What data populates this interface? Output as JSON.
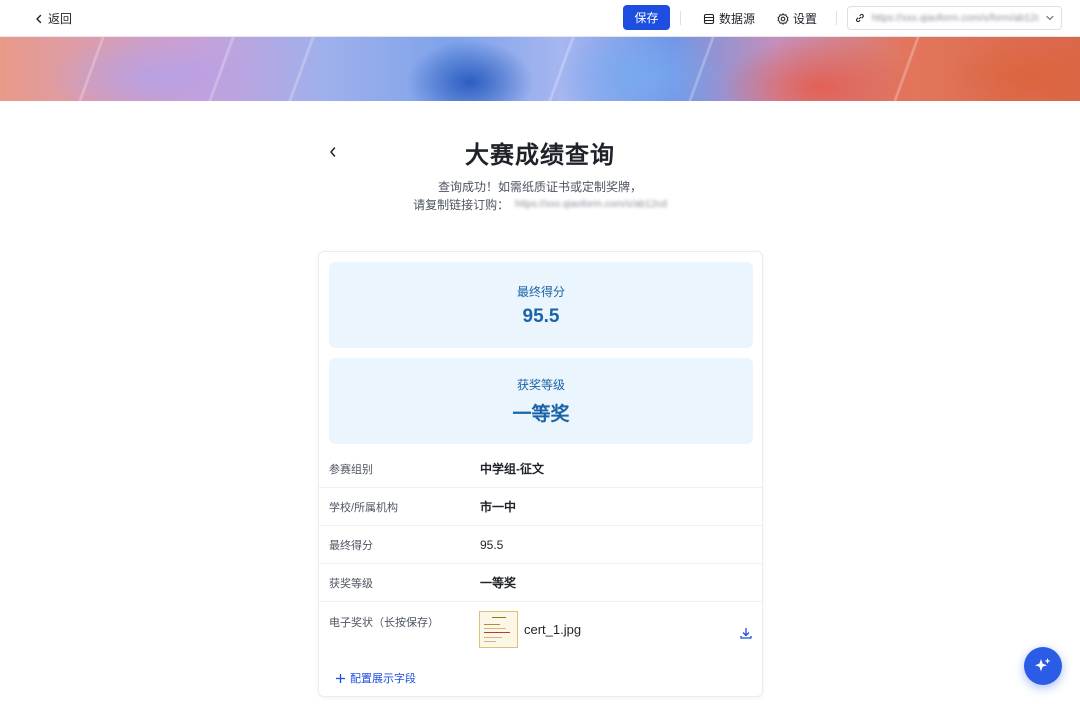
{
  "topbar": {
    "back_label": "返回",
    "save_label": "保存",
    "datasource_label": "数据源",
    "settings_label": "设置",
    "link_value": "https://xxx.qiaoform.com/s/form/ab12cd"
  },
  "page": {
    "title": "大赛成绩查询",
    "subtitle_line1": "查询成功！如需纸质证书或定制奖牌，",
    "subtitle_line2_prefix": "请复制链接订购：",
    "order_link": "https://xxx.qiaoform.com/s/ab12cd"
  },
  "result": {
    "score_label": "最终得分",
    "score_value": "95.5",
    "award_label": "获奖等级",
    "award_value": "一等奖"
  },
  "fields": [
    {
      "label": "参赛组别",
      "value": "中学组-征文"
    },
    {
      "label": "学校/所属机构",
      "value": "市一中"
    },
    {
      "label": "最终得分",
      "value": "95.5"
    },
    {
      "label": "获奖等级",
      "value": "一等奖"
    },
    {
      "label": "电子奖状（长按保存）",
      "value": "cert_1.jpg"
    }
  ],
  "config_label": "配置展示字段",
  "colors": {
    "primary": "#1d4ee0",
    "score_bg": "#eaf5fd",
    "score_text": "#1b63a8"
  }
}
